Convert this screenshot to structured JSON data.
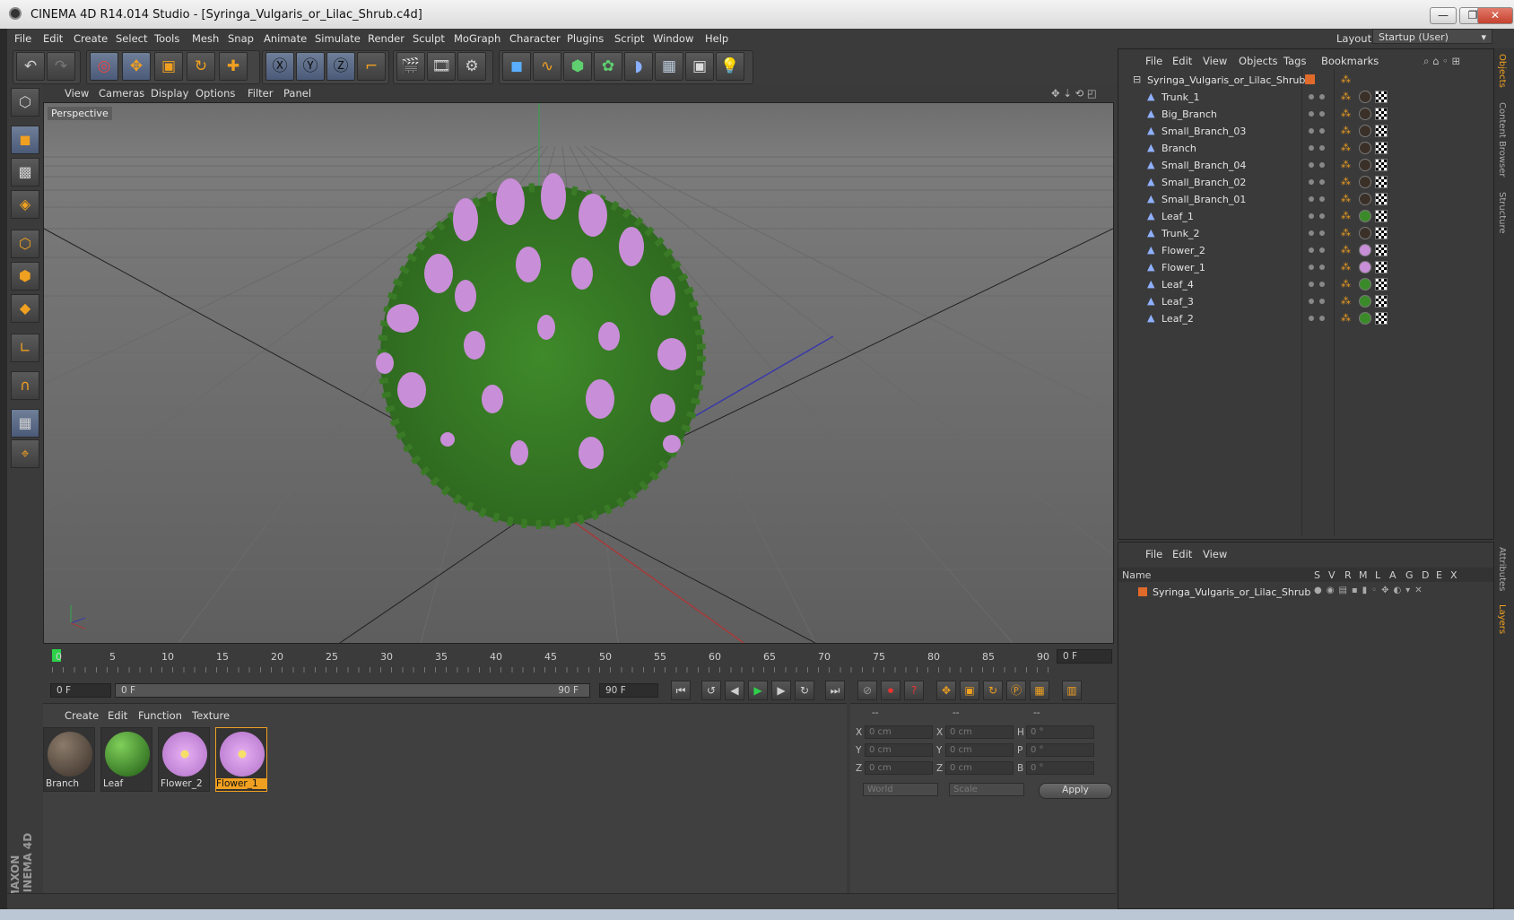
{
  "window": {
    "title": "CINEMA 4D R14.014 Studio - [Syringa_Vulgaris_or_Lilac_Shrub.c4d]",
    "min": "—",
    "max": "❐",
    "close": "✕"
  },
  "menu": [
    "File",
    "Edit",
    "Create",
    "Select",
    "Tools",
    "Mesh",
    "Snap",
    "Animate",
    "Simulate",
    "Render",
    "Sculpt",
    "MoGraph",
    "Character",
    "Plugins",
    "Script",
    "Window",
    "Help"
  ],
  "layout": {
    "label": "Layout:",
    "value": "Startup (User)"
  },
  "viewport": {
    "menu": [
      "View",
      "Cameras",
      "Display",
      "Options",
      "Filter",
      "Panel"
    ],
    "label": "Perspective"
  },
  "timeline": {
    "ticks": [
      "0",
      "5",
      "10",
      "15",
      "20",
      "25",
      "30",
      "35",
      "40",
      "45",
      "50",
      "55",
      "60",
      "65",
      "70",
      "75",
      "80",
      "85",
      "90"
    ],
    "current": "0 F"
  },
  "transport": {
    "start": "0 F",
    "range_start": "0 F",
    "range_end": "90 F",
    "end": "90 F"
  },
  "materials": {
    "menu": [
      "Create",
      "Edit",
      "Function",
      "Texture"
    ],
    "items": [
      "Branch",
      "Leaf",
      "Flower_2",
      "Flower_1"
    ]
  },
  "coords": {
    "headers": [
      "--",
      "--",
      "--"
    ],
    "rows": [
      [
        "X",
        "0 cm",
        "X",
        "0 cm",
        "H",
        "0 °"
      ],
      [
        "Y",
        "0 cm",
        "Y",
        "0 cm",
        "P",
        "0 °"
      ],
      [
        "Z",
        "0 cm",
        "Z",
        "0 cm",
        "B",
        "0 °"
      ]
    ],
    "world": "World",
    "scale": "Scale",
    "apply": "Apply"
  },
  "objects": {
    "menu": [
      "File",
      "Edit",
      "View",
      "Objects",
      "Tags",
      "Bookmarks"
    ],
    "root": "Syringa_Vulgaris_or_Lilac_Shrub",
    "items": [
      "Trunk_1",
      "Big_Branch",
      "Small_Branch_03",
      "Branch",
      "Small_Branch_04",
      "Small_Branch_02",
      "Small_Branch_01",
      "Leaf_1",
      "Trunk_2",
      "Flower_2",
      "Flower_1",
      "Leaf_4",
      "Leaf_3",
      "Leaf_2"
    ]
  },
  "layers": {
    "menu": [
      "File",
      "Edit",
      "View"
    ],
    "header": "Name",
    "cols": [
      "S",
      "V",
      "R",
      "M",
      "L",
      "A",
      "G",
      "D",
      "E",
      "X"
    ],
    "row": "Syringa_Vulgaris_or_Lilac_Shrub"
  },
  "righttabs": [
    "Objects",
    "Content Browser",
    "Structure",
    "Attributes",
    "Layers"
  ],
  "brand": "MAXON CINEMA 4D",
  "colors": {
    "accent": "#f0a020",
    "leaf": "#4d9a32",
    "flower": "#c98ed8",
    "trunk": "#5a4a3a"
  }
}
